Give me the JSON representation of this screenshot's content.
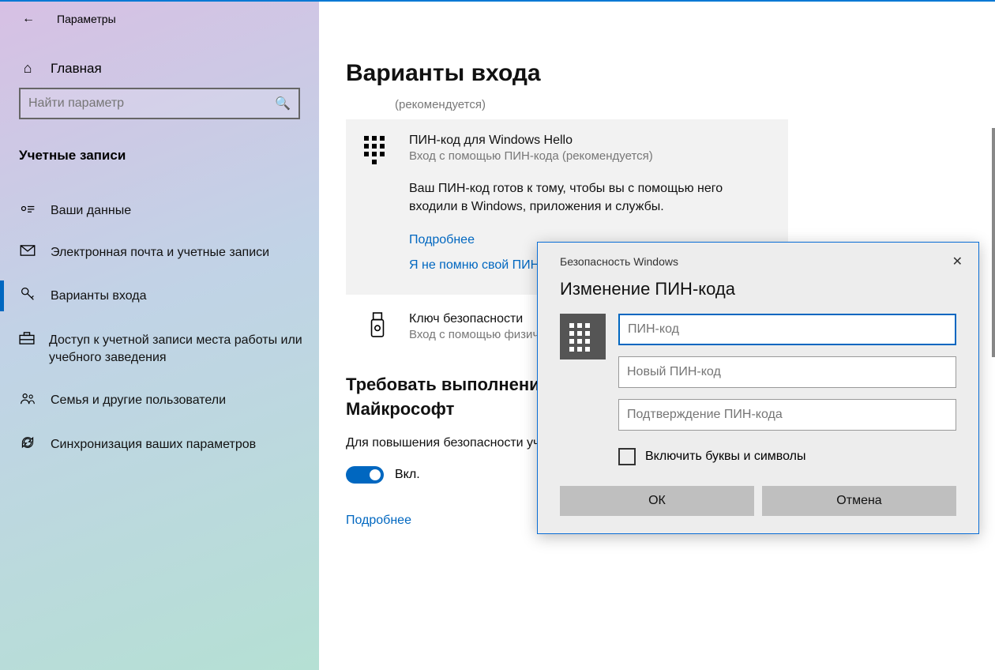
{
  "titlebar": {
    "label": "Параметры"
  },
  "sidebar": {
    "home": "Главная",
    "search_placeholder": "Найти параметр",
    "category": "Учетные записи",
    "items": [
      {
        "label": "Ваши данные"
      },
      {
        "label": "Электронная почта и учетные записи"
      },
      {
        "label": "Варианты входа"
      },
      {
        "label": "Доступ к учетной записи места работы или учебного заведения"
      },
      {
        "label": "Семья и другие пользователи"
      },
      {
        "label": "Синхронизация ваших параметров"
      }
    ]
  },
  "main": {
    "title": "Варианты входа",
    "recommended": "(рекомендуется)",
    "pin_card": {
      "title": "ПИН-код для Windows Hello",
      "subtitle": "Вход с помощью ПИН-кода (рекомендуется)",
      "body": "Ваш ПИН-код готов к тому, чтобы вы с помощью него входили в Windows, приложения и службы.",
      "more": "Подробнее",
      "forgot": "Я не помню свой ПИН-"
    },
    "key_option": {
      "title": "Ключ безопасности",
      "subtitle": "Вход с помощью физич"
    },
    "hello_section": {
      "heading": "Требовать выполнени Windows Hello для уч Майкрософт",
      "body": "Для повышения безопасности учетных записей Майкрософт",
      "toggle_state": "Вкл."
    },
    "more": "Подробнее"
  },
  "dialog": {
    "title": "Безопасность Windows",
    "heading": "Изменение ПИН-кода",
    "pin_placeholder": "ПИН-код",
    "new_pin_placeholder": "Новый ПИН-код",
    "confirm_pin_placeholder": "Подтверждение ПИН-кода",
    "checkbox_label": "Включить буквы и символы",
    "ok": "ОК",
    "cancel": "Отмена"
  }
}
